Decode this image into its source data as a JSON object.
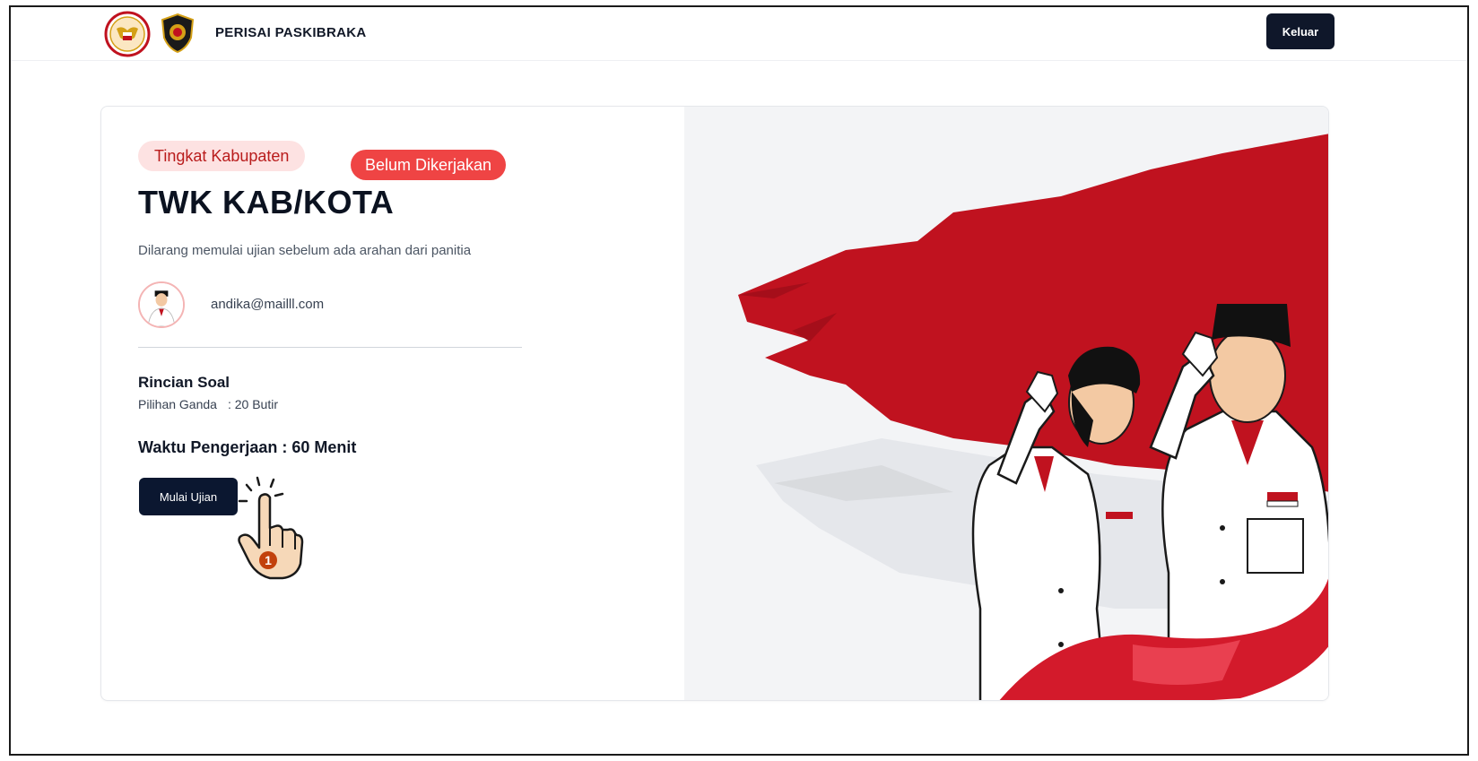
{
  "header": {
    "brand": "PERISAI PASKIBRAKA",
    "logout_label": "Keluar"
  },
  "card": {
    "level_badge": "Tingkat Kabupaten",
    "status_badge": "Belum Dikerjakan",
    "title": "TWK KAB/KOTA",
    "notice": "Dilarang memulai ujian sebelum ada arahan dari panitia",
    "user_email": "andika@mailll.com",
    "details_title": "Rincian Soal",
    "question_type": "Pilihan Ganda",
    "question_count": ": 20 Butir",
    "duration": "Waktu Pengerjaan : 60 Menit",
    "start_label": "Mulai Ujian"
  },
  "annotation": {
    "step_number": "1"
  },
  "colors": {
    "primary_dark": "#0b1730",
    "status_red": "#ef4444",
    "level_badge_bg": "#fde2e2",
    "flag_red": "#c0121f"
  },
  "icons": {
    "logo_left": "garuda-emblem-icon",
    "logo_right": "paskibraka-shield-icon",
    "pointer": "pointing-hand-icon"
  }
}
